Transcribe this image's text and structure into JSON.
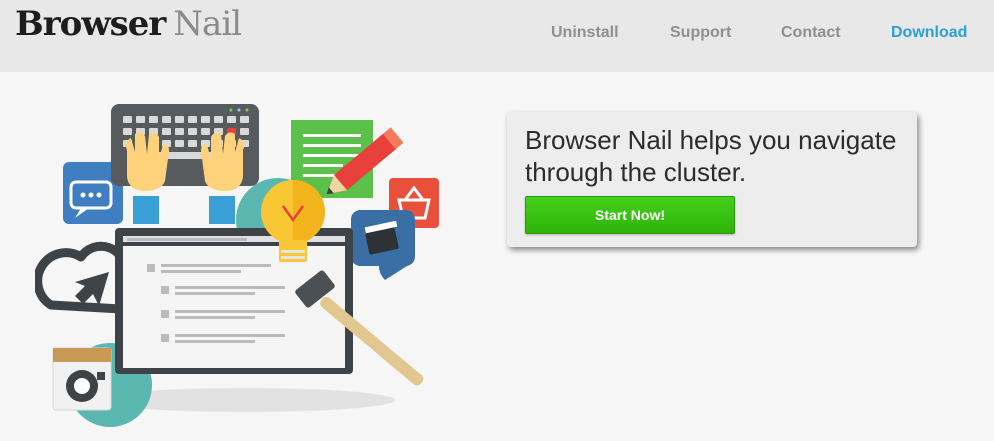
{
  "brand": {
    "word1": "Browser",
    "word2": "Nail"
  },
  "nav": [
    {
      "label": "Uninstall"
    },
    {
      "label": "Support"
    },
    {
      "label": "Contact"
    },
    {
      "label": "Download",
      "active": true
    }
  ],
  "hero": {
    "headline": "Browser Nail helps you navigate through the cluster.",
    "cta_label": "Start Now!"
  },
  "colors": {
    "nav_active": "#2aa0d8",
    "cta_green": "#3cc312",
    "header_bg": "#e8e8e8"
  }
}
